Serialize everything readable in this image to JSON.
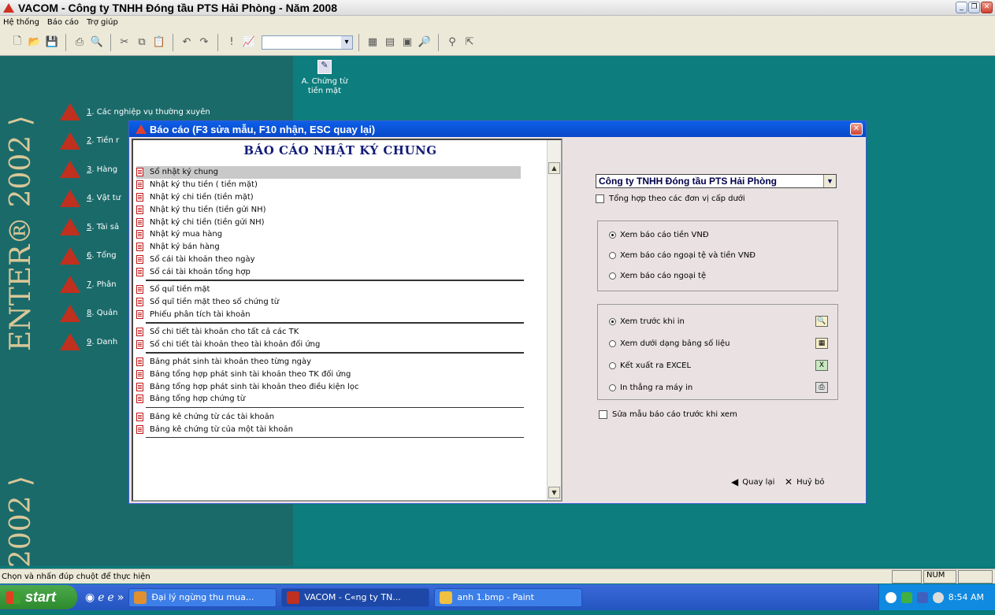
{
  "window": {
    "title": "VACOM - Công ty TNHH Đóng tầu PTS Hải Phòng - Năm 2008"
  },
  "menu": [
    "Hệ thống",
    "Báo cáo",
    "Trợ giúp"
  ],
  "brand": {
    "text1": "ENTER® 2002 ⟩",
    "text2": "2002 ⟩"
  },
  "left_menu": [
    {
      "num": "1",
      "label": ". Các nghiệp vụ thường xuyên"
    },
    {
      "num": "2",
      "label": ". Tiền r"
    },
    {
      "num": "3",
      "label": ". Hàng"
    },
    {
      "num": "4",
      "label": ". Vật tư"
    },
    {
      "num": "5",
      "label": ". Tài sả"
    },
    {
      "num": "6",
      "label": ". Tổng"
    },
    {
      "num": "7",
      "label": ". Phân"
    },
    {
      "num": "8",
      "label": ". Quản"
    },
    {
      "num": "9",
      "label": ". Danh"
    }
  ],
  "shortcut": {
    "label1": "A. Chứng từ",
    "label2": "tiền mặt"
  },
  "dialog": {
    "title": "Báo cáo (F3 sửa mẫu, F10 nhận, ESC quay lại)",
    "list_header": "BÁO CÁO NHẬT KÝ CHUNG",
    "groups": [
      [
        "Sổ nhật ký chung",
        "Nhật ký thu tiền ( tiền mặt)",
        "Nhật ký chi tiền (tiền mặt)",
        "Nhật ký thu tiền (tiền gửi NH)",
        "Nhật ký chi tiền (tiền gửi NH)",
        "Nhật ký mua hàng",
        "Nhật ký bán hàng",
        "Sổ cái tài khoản theo ngày",
        "Sổ cái tài khoản tổng hợp"
      ],
      [
        "Sổ quĩ tiền mặt",
        "Sổ quĩ tiền mặt theo số chứng từ",
        "Phiếu phân tích tài khoản"
      ],
      [
        "Sổ chi tiết tài khoản cho tất cả các TK",
        "Sổ chi tiết tài khoản theo tài khoản đối ứng"
      ],
      [
        "Bảng phát sinh tài khoản theo từng ngày",
        "Bảng tổng hợp phát sinh tài khoản theo TK đối ứng",
        "Bảng tổng hợp phát sinh tài khoản theo điều kiện lọc",
        "Bảng tổng hợp chứng từ"
      ],
      [
        "Bảng kê chứng từ các tài khoản",
        "Bảng kê chứng từ của một tài khoản"
      ]
    ],
    "selected": "Sổ nhật ký chung",
    "company": "Công ty TNHH Đóng tầu PTS Hải Phòng",
    "consolidate_label": "Tổng hợp theo các đơn vị cấp dưới",
    "currency_options": [
      "Xem báo cáo tiền VNĐ",
      "Xem báo cáo ngoại tệ và tiền VNĐ",
      "Xem báo cáo ngoại tệ"
    ],
    "output_options": [
      "Xem trước khi in",
      "Xem dưới dạng bảng số liệu",
      "Kết xuất ra EXCEL",
      "In thẳng ra máy in"
    ],
    "edit_template_label": "Sửa mẫu báo cáo trước khi xem",
    "back_label": "Quay lại",
    "cancel_label": "Huỷ bỏ"
  },
  "status": {
    "text": "Chọn và nhấn đúp chuột để thực hiện",
    "num": "NUM"
  },
  "taskbar": {
    "start": "start",
    "tasks": [
      "Đại lý ngừng thu mua...",
      "VACOM - C«ng ty TN...",
      "anh 1.bmp - Paint"
    ],
    "clock": "8:54 AM"
  }
}
